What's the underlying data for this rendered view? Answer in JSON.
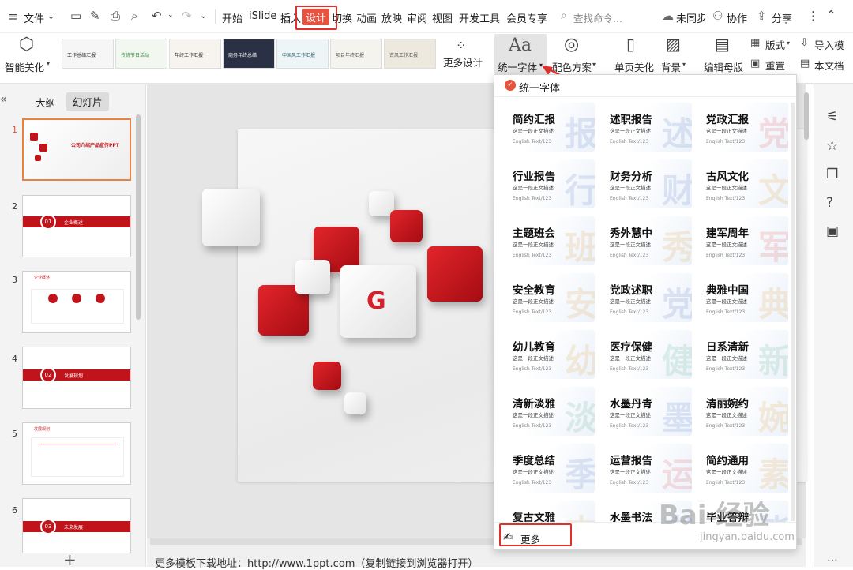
{
  "menubar": {
    "file_label": "文件",
    "tabs": [
      "开始",
      "iSlide",
      "插入",
      "设计",
      "切换",
      "动画",
      "放映",
      "审阅",
      "视图",
      "开发工具",
      "会员专享"
    ],
    "search_placeholder": "查找命令...",
    "sync_label": "未同步",
    "collab_label": "协作",
    "share_label": "分享"
  },
  "toolbar": {
    "smart_beautify": "智能美化",
    "more_design": "更多设计",
    "unify_font": "统一字体",
    "color_scheme": "配色方案",
    "page_beautify": "单页美化",
    "background": "背景",
    "edit_master": "编辑母版",
    "layout": "版式",
    "reset": "重置",
    "import": "导入模",
    "text_box": "本文档",
    "unify_font_icon_text": "Aa",
    "template_thumbs": [
      {
        "text": "工作总结汇报"
      },
      {
        "text": "传统节日活动"
      },
      {
        "text": "年终工作汇报"
      },
      {
        "text": "商务年终总结"
      },
      {
        "text": "中国风工作汇报"
      },
      {
        "text": "项目年终汇报"
      },
      {
        "text": "古风工作汇报"
      }
    ]
  },
  "left_panel": {
    "tab_outline": "大纲",
    "tab_slides": "幻灯片",
    "slides": [
      {
        "num": "1",
        "title": "公司介绍产品宣传PPT"
      },
      {
        "num": "2",
        "title": "企业概述",
        "badge": "01"
      },
      {
        "num": "3",
        "title": "企业概述"
      },
      {
        "num": "4",
        "title": "发展规划",
        "badge": "02"
      },
      {
        "num": "5",
        "title": "发展规划"
      },
      {
        "num": "6",
        "title": "未来发展",
        "badge": "03"
      }
    ]
  },
  "status": {
    "text": "更多模板下载地址：http://www.1ppt.com（复制链接到浏览器打开）"
  },
  "dropdown": {
    "header": "统一字体",
    "more_label": "更多",
    "card_sub": "这是一段正文描述",
    "card_eng": "English Text/123",
    "cards": [
      {
        "title": "简约汇报",
        "wm": "报",
        "wc": "#5b7fc8"
      },
      {
        "title": "述职报告",
        "wm": "述",
        "wc": "#5b7fc8"
      },
      {
        "title": "党政汇报",
        "wm": "党",
        "wc": "#e05a5a"
      },
      {
        "title": "行业报告",
        "wm": "行",
        "wc": "#5b7fc8"
      },
      {
        "title": "财务分析",
        "wm": "财",
        "wc": "#5b7fc8"
      },
      {
        "title": "古风文化",
        "wm": "文",
        "wc": "#e0a040"
      },
      {
        "title": "主题班会",
        "wm": "班",
        "wc": "#e0a040"
      },
      {
        "title": "秀外慧中",
        "wm": "秀",
        "wc": "#e0a040"
      },
      {
        "title": "建军周年",
        "wm": "军",
        "wc": "#e05a5a"
      },
      {
        "title": "安全教育",
        "wm": "安",
        "wc": "#e0a040"
      },
      {
        "title": "党政述职",
        "wm": "党",
        "wc": "#5b7fc8"
      },
      {
        "title": "典雅中国",
        "wm": "典",
        "wc": "#e0a040"
      },
      {
        "title": "幼儿教育",
        "wm": "幼",
        "wc": "#e0a040"
      },
      {
        "title": "医疗保健",
        "wm": "健",
        "wc": "#5bb08c"
      },
      {
        "title": "日系清新",
        "wm": "新",
        "wc": "#5bb08c"
      },
      {
        "title": "清新淡雅",
        "wm": "淡",
        "wc": "#5bb08c"
      },
      {
        "title": "水墨丹青",
        "wm": "墨",
        "wc": "#5b7fc8"
      },
      {
        "title": "清丽婉约",
        "wm": "婉",
        "wc": "#e0a040"
      },
      {
        "title": "季度总结",
        "wm": "季",
        "wc": "#5b7fc8"
      },
      {
        "title": "运营报告",
        "wm": "运",
        "wc": "#e05a5a"
      },
      {
        "title": "简约通用",
        "wm": "素",
        "wc": "#e0a040"
      },
      {
        "title": "复古文雅",
        "wm": "古",
        "wc": "#e0a040"
      },
      {
        "title": "水墨书法",
        "wm": "书",
        "wc": "#5b7fc8"
      },
      {
        "title": "毕业答辩",
        "wm": "毕",
        "wc": "#5b7fc8"
      }
    ]
  },
  "watermark": {
    "text": "Bai 经验",
    "sub": "jingyan.baidu.com"
  },
  "colors": {
    "accent": "#e03a2f",
    "active_tab_bg": "#e8533f",
    "highlight_box": "#e0302c"
  },
  "icons": [
    "chevron-down-icon",
    "save-icon",
    "print-icon",
    "undo-icon",
    "redo-icon",
    "search-icon",
    "cloud-icon",
    "user-icon",
    "share-icon",
    "more-icon",
    "expand-icon",
    "pen-icon"
  ]
}
